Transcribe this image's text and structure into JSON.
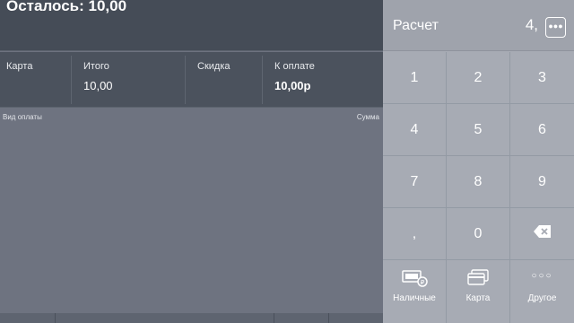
{
  "header": {
    "remaining_text": "Осталось: 10,00"
  },
  "totals": [
    {
      "label": "Карта",
      "value": ""
    },
    {
      "label": "Итого",
      "value": "10,00"
    },
    {
      "label": "Скидка",
      "value": ""
    },
    {
      "label": "К оплате",
      "value": "10,00р"
    }
  ],
  "payments_table": {
    "col_method": "Вид оплаты",
    "col_sum": "Сумма"
  },
  "calculator": {
    "title": "Расчет",
    "display": "4,",
    "more_icon": "ellipsis-icon",
    "keys": [
      "1",
      "2",
      "3",
      "4",
      "5",
      "6",
      "7",
      "8",
      "9",
      ",",
      "0"
    ],
    "backspace_icon": "backspace-icon",
    "methods": [
      {
        "label": "Наличные",
        "icon": "cash-icon"
      },
      {
        "label": "Карта",
        "icon": "card-icon"
      },
      {
        "label": "Другое",
        "icon": "ellipsis-icon"
      }
    ]
  },
  "colors": {
    "panel_dark": "#454c57",
    "calc_bg": "#a7abb4",
    "content_bg": "#6e7380"
  }
}
